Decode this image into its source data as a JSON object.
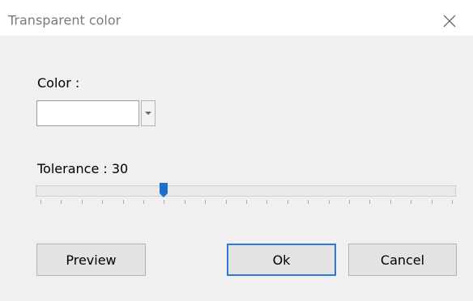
{
  "dialog": {
    "title": "Transparent color",
    "close_icon": "close-icon"
  },
  "color": {
    "label": "Color :",
    "value": "#ffffff",
    "dropdown_icon": "triangle-down-icon"
  },
  "tolerance": {
    "label": "Tolerance : 30",
    "value": 30,
    "min": 0,
    "max": 100,
    "tick_count": 20
  },
  "buttons": {
    "preview": "Preview",
    "ok": "Ok",
    "cancel": "Cancel"
  },
  "colors": {
    "accent": "#2d7ad6",
    "thumb": "#1a6fcf"
  }
}
